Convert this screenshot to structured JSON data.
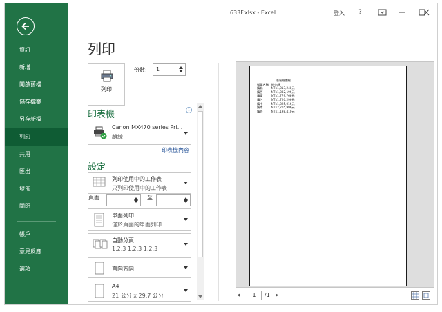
{
  "window": {
    "title": "633F.xlsx - Excel",
    "login": "登入",
    "help": "?"
  },
  "nav": {
    "items": [
      {
        "label": "資訊"
      },
      {
        "label": "新增"
      },
      {
        "label": "開啟舊檔"
      },
      {
        "label": "儲存檔案"
      },
      {
        "label": "另存新檔"
      },
      {
        "label": "列印"
      },
      {
        "label": "共用"
      },
      {
        "label": "匯出"
      },
      {
        "label": "發佈"
      },
      {
        "label": "關閉"
      },
      {
        "label": "帳戶"
      },
      {
        "label": "意見反應"
      },
      {
        "label": "選項"
      }
    ]
  },
  "print": {
    "page_title": "列印",
    "print_button_label": "列印",
    "copies_label": "份數:",
    "copies_value": "1"
  },
  "printer": {
    "heading": "印表機",
    "name": "Canon MX470 series Pri...",
    "status": "離線",
    "properties_link": "印表機內容"
  },
  "settings": {
    "heading": "設定",
    "scope": {
      "line1": "列印使用中的工作表",
      "line2": "只列印使用中的工作表"
    },
    "pages_label": "頁面:",
    "to_label": "至",
    "sides": {
      "line1": "單面列印",
      "line2": "僅於頁面的單面列印"
    },
    "collate": {
      "line1": "自動分頁",
      "line2": "1,2,3    1,2,3    1,2,3"
    },
    "orientation": {
      "line1": "直向方向"
    },
    "paper": {
      "line1": "A4",
      "line2": "21 公分 x 29.7 公分"
    }
  },
  "preview": {
    "sheet_header": [
      "鄉鎮名稱",
      "總金額"
    ],
    "sheet_title": "各區總價格",
    "rows": [
      [
        "鎮北",
        "NT$1,813,248元"
      ],
      [
        "鎮西",
        "NT$1,832,196元"
      ],
      [
        "鎮東",
        "NT$1,779,768元"
      ],
      [
        "鎮內",
        "NT$1,720,296元"
      ],
      [
        "鎮中",
        "NT$1,895,016元"
      ],
      [
        "鎮南",
        "NT$2,205,996元"
      ],
      [
        "鎮外",
        "NT$1,198,410元"
      ]
    ],
    "current_page": "1",
    "total_pages": "/1"
  },
  "colors": {
    "nav_bg": "#217346",
    "nav_active": "#0f5c34",
    "accent": "#217346"
  }
}
